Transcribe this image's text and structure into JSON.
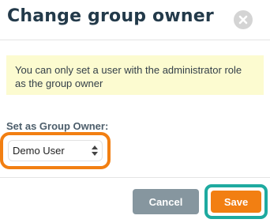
{
  "dialog": {
    "title": "Change group owner",
    "close_icon": "close-circle-icon"
  },
  "notice": {
    "text": "You can only set a user with the administrator role as the group owner",
    "background": "#fcfbd0"
  },
  "owner_field": {
    "label": "Set as Group Owner:",
    "selected_value": "Demo User",
    "icon": "updown-arrows-icon"
  },
  "footer": {
    "cancel_label": "Cancel",
    "save_label": "Save"
  },
  "colors": {
    "title": "#233a4a",
    "highlight_orange": "#f27f12",
    "highlight_teal": "#1eaaa0",
    "cancel_bg": "#86969f",
    "save_bg": "#f27f12"
  }
}
